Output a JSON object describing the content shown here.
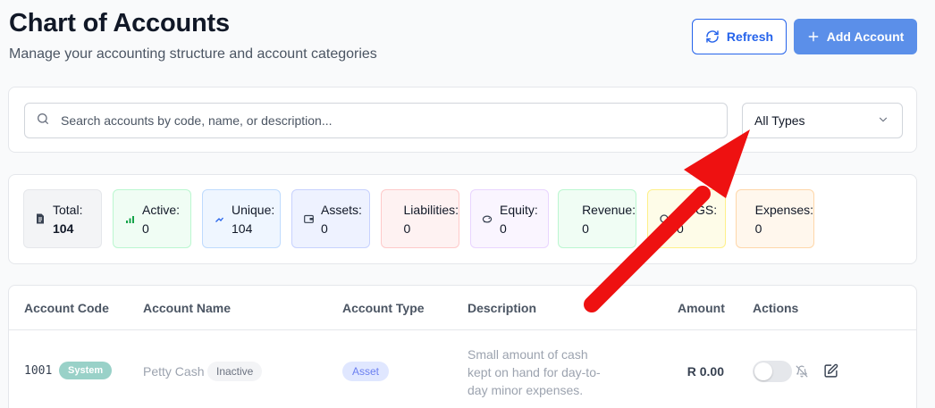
{
  "header": {
    "title": "Chart of Accounts",
    "subtitle": "Manage your accounting structure and account categories",
    "refresh_label": "Refresh",
    "add_label": "Add Account"
  },
  "filters": {
    "search_placeholder": "Search accounts by code, name, or description...",
    "search_value": "",
    "type_selected": "All Types"
  },
  "stats": [
    {
      "label": "Total:",
      "value": "104",
      "icon": "document-icon"
    },
    {
      "label": "Active:",
      "value": "0",
      "icon": "signal-icon"
    },
    {
      "label": "Unique:",
      "value": "104",
      "icon": "trend-icon"
    },
    {
      "label": "Assets:",
      "value": "0",
      "icon": "wallet-icon"
    },
    {
      "label": "Liabilities:",
      "value": "0",
      "icon": "credit-card-icon"
    },
    {
      "label": "Equity:",
      "value": "0",
      "icon": "piggy-bank-icon"
    },
    {
      "label": "Revenue:",
      "value": "0",
      "icon": "trending-up-icon"
    },
    {
      "label": "COGS:",
      "value": "0",
      "icon": "package-icon"
    },
    {
      "label": "Expenses:",
      "value": "0",
      "icon": "receipt-icon"
    }
  ],
  "table": {
    "columns": [
      "Account Code",
      "Account Name",
      "Account Type",
      "Description",
      "Amount",
      "Actions"
    ],
    "rows": [
      {
        "code": "1001",
        "system_badge": "System",
        "name": "Petty Cash",
        "status": "Inactive",
        "type": "Asset",
        "description": "Small amount of cash kept on hand for day-to-day minor expenses.",
        "amount": "R 0.00"
      }
    ]
  },
  "colors": {
    "primary": "#2563eb",
    "add_button": "#5b8fe9",
    "annotation_arrow": "#ee1111"
  }
}
